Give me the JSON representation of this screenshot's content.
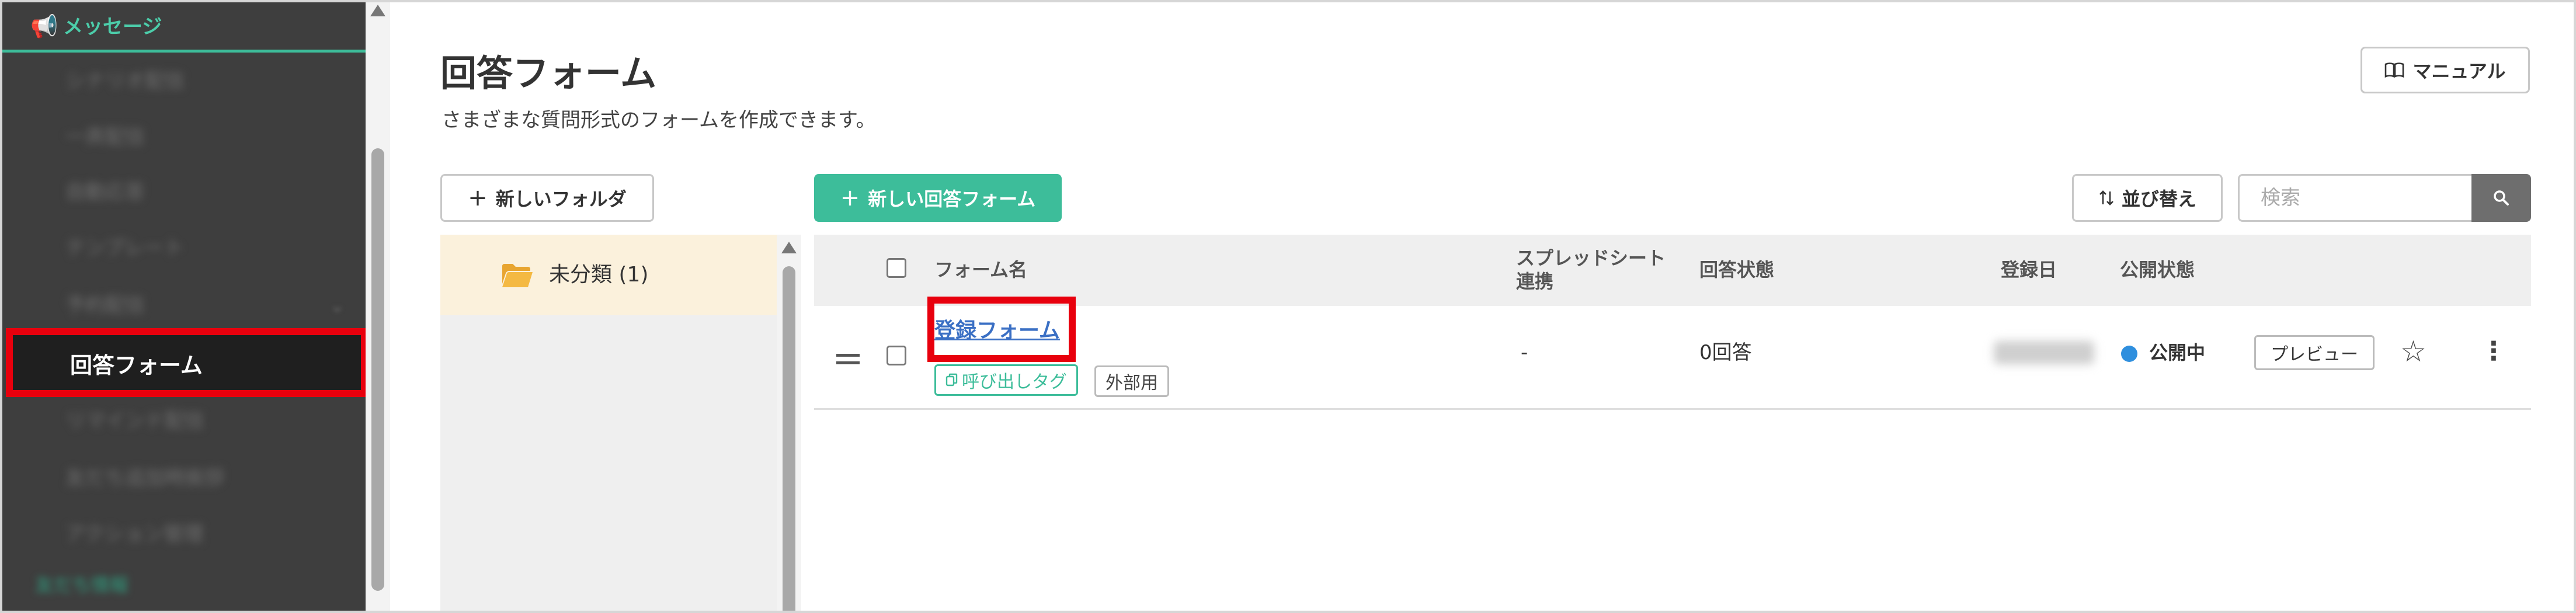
{
  "sidebar": {
    "header_icon": "megaphone-icon",
    "header_label": "メッセージ",
    "blurred_items": [
      "シナリオ配信",
      "一斉配信",
      "自動応答",
      "テンプレート",
      "予約配信"
    ],
    "active_item": "回答フォーム",
    "blurred_items_after": [
      "リマインド配信",
      "友だち追加時挨拶",
      "アクション管理"
    ],
    "footer_item": "友だち情報"
  },
  "header": {
    "title": "回答フォーム",
    "subtitle": "さまざまな質問形式のフォームを作成できます。",
    "manual_label": "マニュアル",
    "manual_icon": "book-icon"
  },
  "toolbar": {
    "new_folder_label": "新しいフォルダ",
    "new_form_label": "新しい回答フォーム",
    "sort_label": "並び替え",
    "search_placeholder": "検索"
  },
  "folders": [
    {
      "label": "未分類 (1)",
      "icon": "folder-open-icon"
    }
  ],
  "table": {
    "columns": {
      "name": "フォーム名",
      "sheet_line1": "スプレッドシート",
      "sheet_line2": "連携",
      "answers": "回答状態",
      "date": "登録日",
      "status": "公開状態"
    },
    "rows": [
      {
        "name": "登録フォーム",
        "tag_call": "呼び出しタグ",
        "tag_external": "外部用",
        "sheet": "-",
        "answers": "0回答",
        "status": "公開中",
        "preview_label": "プレビュー"
      }
    ]
  },
  "colors": {
    "accent": "#3dbd9a",
    "highlight": "#e8000d",
    "status_public": "#2f8fde",
    "link": "#3a6fc4"
  }
}
